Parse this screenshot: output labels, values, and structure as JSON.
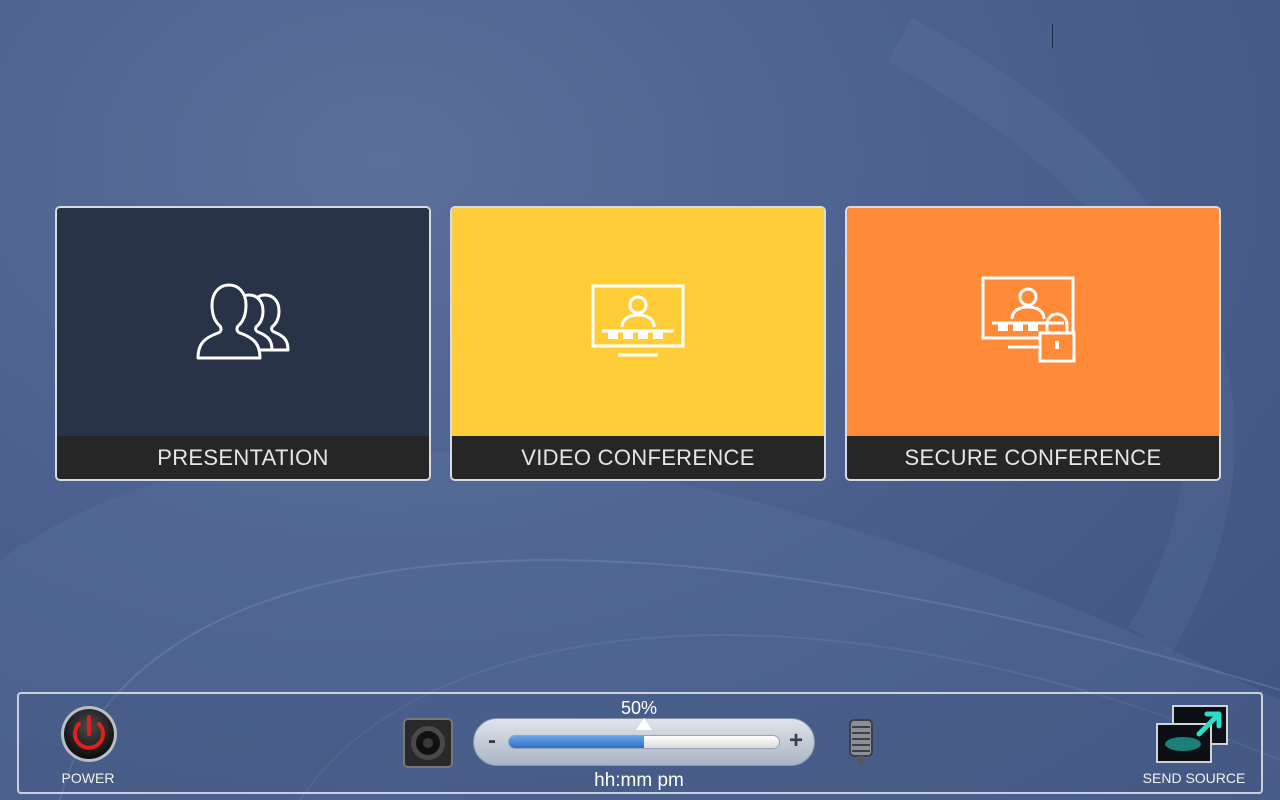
{
  "tiles": [
    {
      "label": "PRESENTATION",
      "icon": "people-group-icon",
      "color": "#283347"
    },
    {
      "label": "VIDEO CONFERENCE",
      "icon": "monitor-user-icon",
      "color": "#ffcd38"
    },
    {
      "label": "SECURE CONFERENCE",
      "icon": "monitor-user-lock-icon",
      "color": "#ff8a38"
    }
  ],
  "bottom_bar": {
    "power_label": "POWER",
    "volume": {
      "percent_label": "50%",
      "level": 0.5,
      "minus": "-",
      "plus": "+"
    },
    "clock": "hh:mm pm",
    "send_source_label": "SEND SOURCE"
  },
  "colors": {
    "background": "#4d6290",
    "tile_label_bg": "#262626",
    "power_accent": "#e02020",
    "volume_fill": "#2f6fc7",
    "send_accent": "#28e0c8"
  }
}
